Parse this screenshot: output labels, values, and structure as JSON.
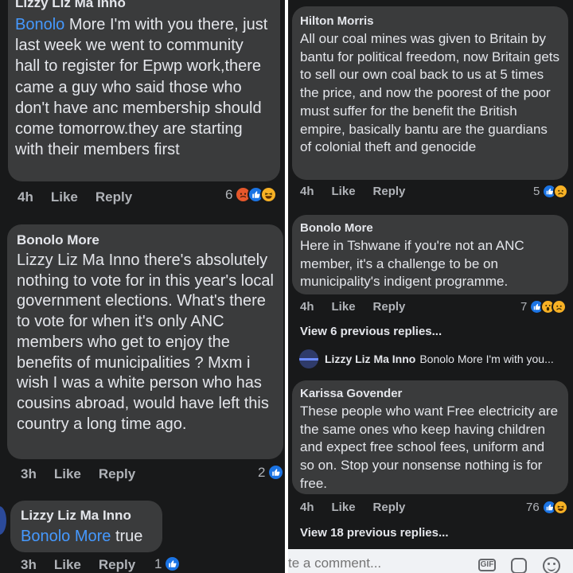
{
  "left": {
    "c1": {
      "name": "Lizzy Liz Ma Inno",
      "mention": "Bonolo",
      "text": " More I'm with you there, just last week we went to community hall to register for Epwp work,there came a guy who said those who don't have anc membership should come tomorrow.they are starting with their members first",
      "time": "4h",
      "like": "Like",
      "reply": "Reply",
      "count": "6",
      "reactions": [
        "angry-icon",
        "like-icon",
        "haha-icon"
      ]
    },
    "c2": {
      "name": "Bonolo More",
      "text": "Lizzy Liz Ma Inno there's absolutely nothing to vote for in this year's local government elections. What's there to vote for when it's only ANC members who get to enjoy the benefits of municipalities ? Mxm i wish I was a white person who has cousins abroad, would have left this country a long time ago.",
      "time": "3h",
      "like": "Like",
      "reply": "Reply",
      "count": "2",
      "reactions": [
        "like-icon"
      ]
    },
    "c3": {
      "name": "Lizzy Liz Ma Inno",
      "mention": "Bonolo More",
      "text": " true",
      "time": "3h",
      "like": "Like",
      "reply": "Reply",
      "count": "1",
      "reactions": [
        "like-icon"
      ]
    }
  },
  "right": {
    "c1": {
      "name": "Hilton Morris",
      "text": "All our coal mines was given to Britain by bantu for political freedom, now Britain gets to sell our own coal back to us at 5 times the price, and now the poorest of the poor must suffer for the benefit the British empire, basically bantu are the guardians of colonial theft and genocide",
      "time": "4h",
      "like": "Like",
      "reply": "Reply",
      "count": "5",
      "reactions": [
        "like-icon",
        "sad-icon"
      ]
    },
    "c2": {
      "name": "Bonolo More",
      "text": "Here in Tshwane if you're not an ANC member, it's a challenge to be on municipality's indigent programme.",
      "time": "4h",
      "like": "Like",
      "reply": "Reply",
      "count": "7",
      "reactions": [
        "like-icon",
        "wow-icon",
        "sad-icon"
      ]
    },
    "view_replies_1": "View 6 previous replies...",
    "preview_reply": {
      "name": "Lizzy Liz Ma Inno",
      "text": "Bonolo More I'm with you..."
    },
    "c3": {
      "name": "Karissa Govender",
      "text": "These people who want Free electricity are the same ones who keep having children and expect free school fees, uniform and so on. Stop your nonsense nothing is for free.",
      "time": "4h",
      "like": "Like",
      "reply": "Reply",
      "count": "76",
      "reactions": [
        "like-icon",
        "haha-icon"
      ]
    },
    "view_replies_2": "View 18 previous replies...",
    "comment_input": {
      "placeholder": "te a comment..."
    },
    "input_icons": {
      "gif": "GIF"
    }
  },
  "colors": {
    "background": "#18191a",
    "bubble": "#3a3b3c",
    "text": "#e4e6eb",
    "meta": "#b0b3b8",
    "link": "#4599ff",
    "like": "#1b74e4"
  }
}
